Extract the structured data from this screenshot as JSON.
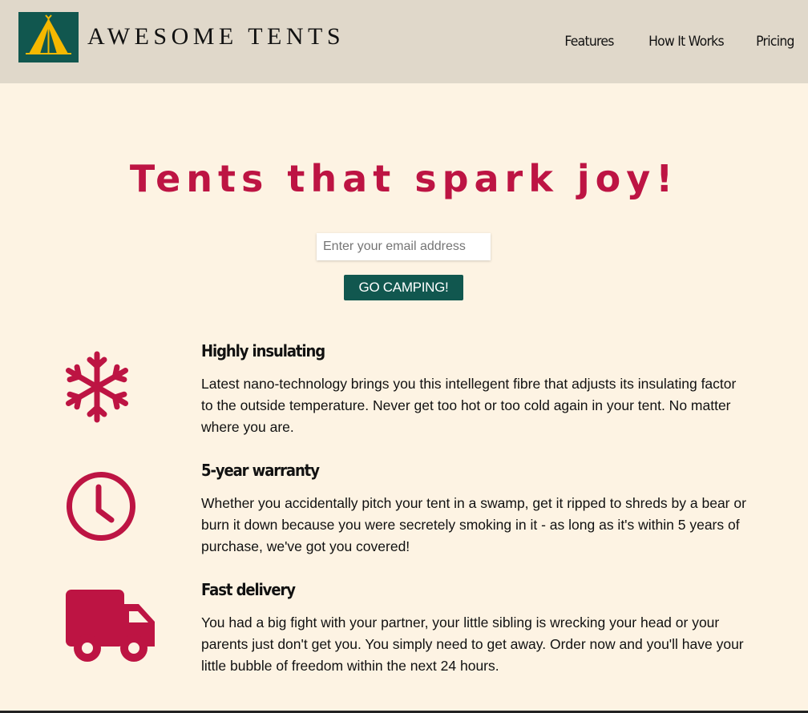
{
  "header": {
    "brand": "AWESOME TENTS",
    "logo_icon": "tent-icon",
    "nav": [
      {
        "label": "Features"
      },
      {
        "label": "How It Works"
      },
      {
        "label": "Pricing"
      }
    ]
  },
  "hero": {
    "title": "Tents that spark joy!",
    "email_placeholder": "Enter your email address",
    "button_label": "GO CAMPING!"
  },
  "features": [
    {
      "icon": "snowflake-icon",
      "title": "Highly insulating",
      "text": "Latest nano-technology brings you this intellegent fibre that adjusts its insulating factor to the outside temperature. Never get too hot or too cold again in your tent. No matter where you are."
    },
    {
      "icon": "clock-icon",
      "title": "5-year warranty",
      "text": "Whether you accidentally pitch your tent in a swamp, get it ripped to shreds by a bear or burn it down because you were secretely smoking in it - as long as it's within 5 years of purchase, we've got you covered!"
    },
    {
      "icon": "truck-icon",
      "title": "Fast delivery",
      "text": "You had a big fight with your partner, your little sibling is wrecking your head or your parents just don't get you. You simply need to get away. Order now and you'll have your little bubble of freedom within the next 24 hours."
    }
  ],
  "colors": {
    "accent": "#bd1443",
    "brand_green": "#11574f",
    "header_bg": "#e0d8ca",
    "page_bg": "#fdf3e3",
    "logo_tent": "#f5b800"
  }
}
